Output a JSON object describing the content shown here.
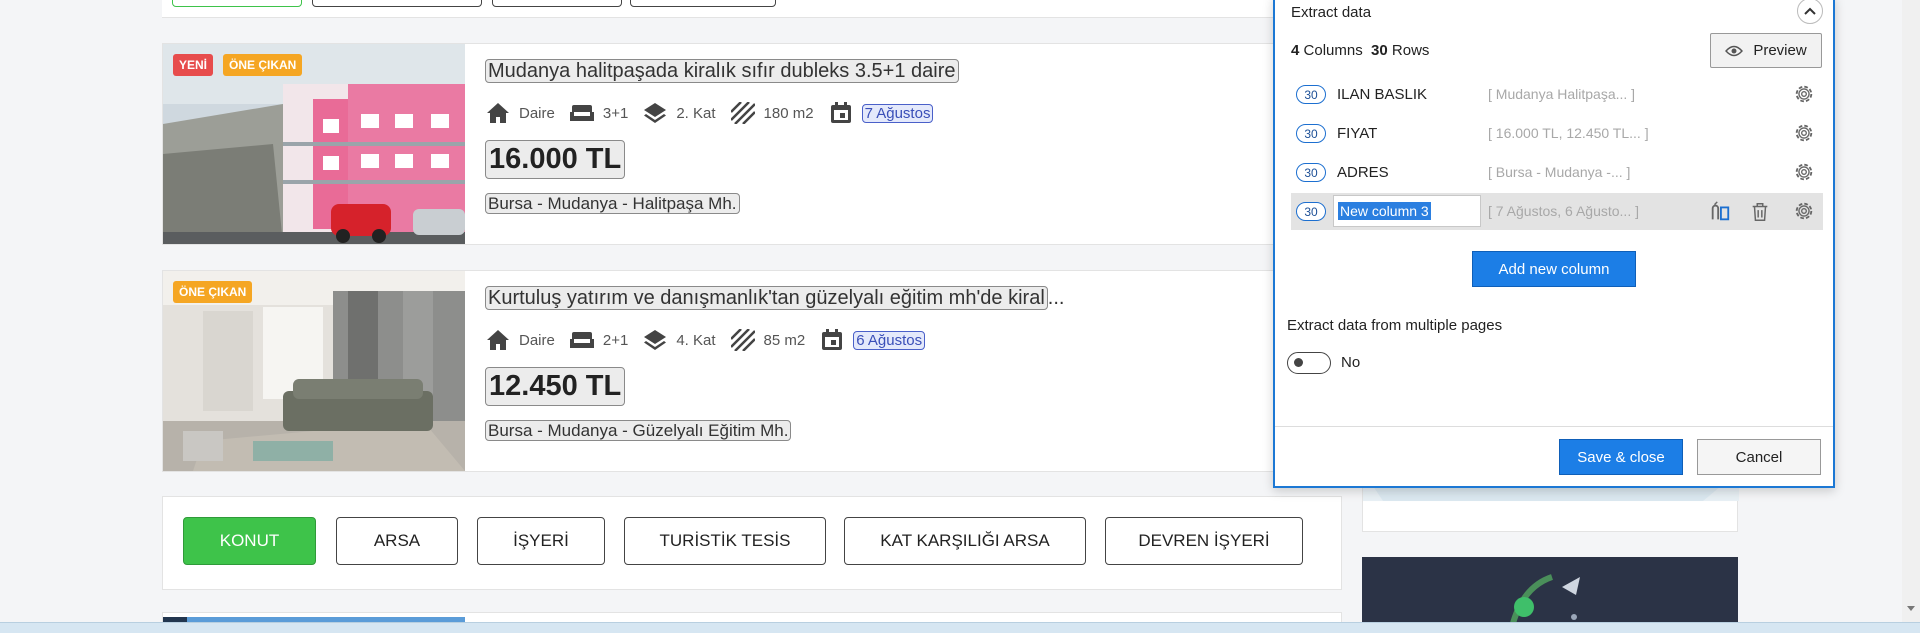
{
  "listings": [
    {
      "badges": [
        "YENİ",
        "ÖNE ÇIKAN"
      ],
      "title": "Mudanya halitpaşada kiralık sıfır dubleks 3.5+1 daire",
      "type": "Daire",
      "rooms": "3+1",
      "floor": "2. Kat",
      "area": "180 m2",
      "date": "7 Ağustos",
      "price": "16.000 TL",
      "address": "Bursa - Mudanya - Halitpaşa Mh."
    },
    {
      "badges": [
        "ÖNE ÇIKAN"
      ],
      "title_main": "Kurtuluş yatırım ve danışmanlık'tan güzelyalı eğitim mh'de kiral",
      "title_suffix": "...",
      "type": "Daire",
      "rooms": "2+1",
      "floor": "4. Kat",
      "area": "85 m2",
      "date": "6 Ağustos",
      "price": "12.450 TL",
      "address": "Bursa - Mudanya - Güzelyalı Eğitim Mh."
    }
  ],
  "categories": [
    {
      "label": "KONUT",
      "active": true
    },
    {
      "label": "ARSA",
      "active": false
    },
    {
      "label": "İŞYERİ",
      "active": false
    },
    {
      "label": "TURİSTİK TESİS",
      "active": false
    },
    {
      "label": "KAT KARŞILIĞI ARSA",
      "active": false
    },
    {
      "label": "DEVREN İŞYERİ",
      "active": false
    }
  ],
  "extract_panel": {
    "title": "Extract data",
    "columns_count": "4",
    "columns_word": "Columns",
    "rows_count": "30",
    "rows_word": "Rows",
    "preview_label": "Preview",
    "columns": [
      {
        "count": "30",
        "name": "ILAN BASLIK",
        "sample": "[ Mudanya Halitpaşa...   ]"
      },
      {
        "count": "30",
        "name": "FIYAT",
        "sample": "[ 16.000 TL, 12.450 TL... ]"
      },
      {
        "count": "30",
        "name": "ADRES",
        "sample": "[ Bursa - Mudanya -...   ]"
      },
      {
        "count": "30",
        "name": "New column 3",
        "sample": "[ 7 Ağustos, 6 Ağusto... ]",
        "editing": true
      }
    ],
    "add_column_label": "Add new column",
    "multi_page_label": "Extract data from multiple pages",
    "multi_page_value": "No",
    "save_label": "Save & close",
    "cancel_label": "Cancel"
  },
  "colors": {
    "accent_blue": "#1c7ee6",
    "category_active_green": "#3ec34a",
    "badge_red": "#e74c4c",
    "badge_orange": "#f5a623"
  }
}
